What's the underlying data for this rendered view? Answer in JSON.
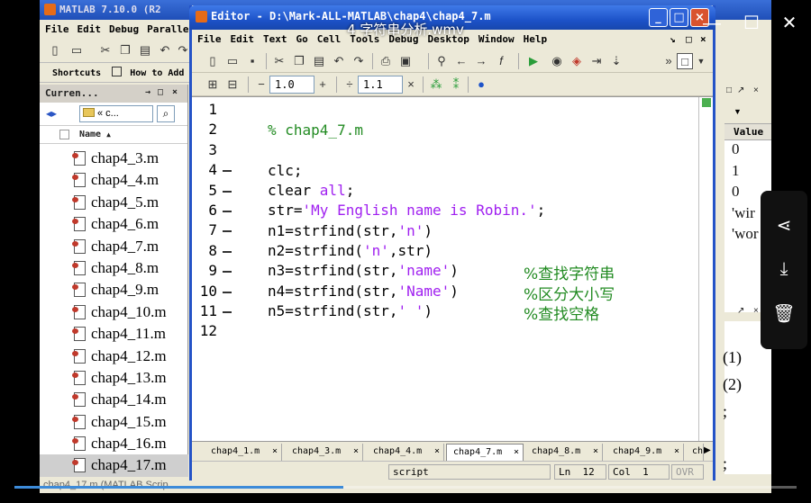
{
  "video": {
    "title": "4 字符串分析.wmv",
    "progress": 0.42
  },
  "player_controls": {
    "minimize": "—",
    "maximize": "☐",
    "close": "✕"
  },
  "main_window": {
    "title": "MATLAB 7.10.0 (R2",
    "menu": [
      "File",
      "Edit",
      "Debug",
      "Paralle"
    ],
    "shortcuts": [
      "Shortcuts",
      "How to Add"
    ],
    "status_text": "chap4_17.m (MATLAB Scrip"
  },
  "current_folder": {
    "title": "Curren...",
    "path": "« c...",
    "column": "Name",
    "files": [
      "chap4_3.m",
      "chap4_4.m",
      "chap4_5.m",
      "chap4_6.m",
      "chap4_7.m",
      "chap4_8.m",
      "chap4_9.m",
      "chap4_10.m",
      "chap4_11.m",
      "chap4_12.m",
      "chap4_13.m",
      "chap4_14.m",
      "chap4_15.m",
      "chap4_16.m",
      "chap4_17.m"
    ],
    "selected_index": 14
  },
  "workspace": {
    "value_header": "Value",
    "values": [
      "0",
      "1",
      "0",
      "'wir",
      "'wor"
    ]
  },
  "history": {
    "lines": [
      "(1)",
      "(2)",
      ";",
      ";"
    ]
  },
  "editor": {
    "title": "Editor - D:\\Mark-ALL-MATLAB\\chap4\\chap4_7.m",
    "menu": [
      "File",
      "Edit",
      "Text",
      "Go",
      "Cell",
      "Tools",
      "Debug",
      "Desktop",
      "Window",
      "Help"
    ],
    "cell_inc_1": "1.0",
    "cell_inc_2": "1.1",
    "line_numbers": [
      "1",
      "2",
      "3",
      "4",
      "5",
      "6",
      "7",
      "8",
      "9",
      "10",
      "11",
      "12"
    ],
    "code": {
      "l2": "% chap4_7.m",
      "l4": "clc;",
      "l5a": "clear ",
      "l5b": "all",
      "l5c": ";",
      "l6a": "str=",
      "l6b": "'My English name is Robin.'",
      "l6c": ";",
      "l7a": "n1=strfind(str,",
      "l7b": "'n'",
      "l7c": ")",
      "l8a": "n2=strfind(",
      "l8b": "'n'",
      "l8c": ",str)",
      "l9a": "n3=strfind(str,",
      "l9b": "'name'",
      "l9c": ")",
      "l9comment": "%查找字符串",
      "l10a": "n4=strfind(str,",
      "l10b": "'Name'",
      "l10c": ")",
      "l10comment": "%区分大小写",
      "l11a": "n5=strfind(str,",
      "l11b": "' '",
      "l11c": ")",
      "l11comment": "%查找空格"
    },
    "tabs": [
      "chap4_1.m",
      "chap4_3.m",
      "chap4_4.m",
      "chap4_7.m",
      "chap4_8.m",
      "chap4_9.m",
      "ch"
    ],
    "active_tab": "chap4_7.m",
    "status": {
      "mode": "script",
      "ln_label": "Ln",
      "ln": "12",
      "col_label": "Col",
      "col": "1",
      "ovr": "OVR"
    }
  },
  "colors": {
    "comment": "#228b22",
    "string": "#a020f0",
    "keyword": "#0000ff",
    "title_bar": "#1d53c9",
    "progress": "#3d8bd9"
  }
}
